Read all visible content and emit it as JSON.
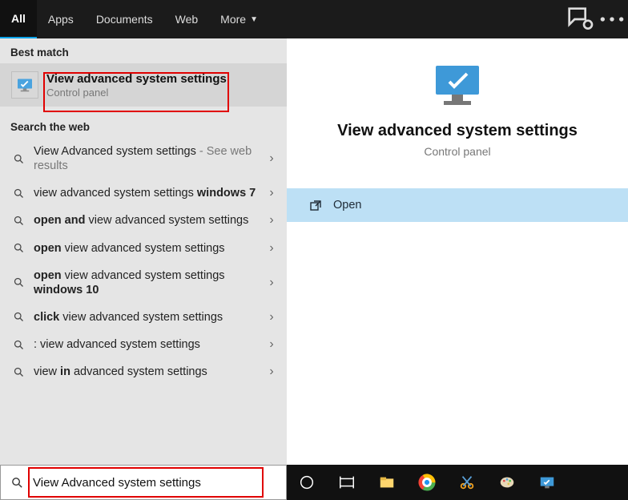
{
  "tabs": {
    "all": "All",
    "apps": "Apps",
    "documents": "Documents",
    "web": "Web",
    "more": "More"
  },
  "left": {
    "best_match_hdr": "Best match",
    "best": {
      "title": "View advanced system settings",
      "subtitle": "Control panel"
    },
    "web_hdr": "Search the web",
    "items": [
      {
        "html": "View Advanced system settings <span style='color:#777'>- See web results</span>"
      },
      {
        "html": "view advanced system settings <b>windows 7</b>"
      },
      {
        "html": "<b>open and</b> view advanced system settings"
      },
      {
        "html": "<b>open</b> view advanced system settings"
      },
      {
        "html": "<b>open</b> view advanced system settings <b>windows 10</b>"
      },
      {
        "html": "<b>click</b> view advanced system settings"
      },
      {
        "html": ": view advanced system settings"
      },
      {
        "html": "view <b>in</b> advanced system settings"
      }
    ]
  },
  "right": {
    "title": "View advanced system settings",
    "subtitle": "Control panel",
    "open": "Open"
  },
  "search": {
    "value": "View Advanced system settings"
  }
}
